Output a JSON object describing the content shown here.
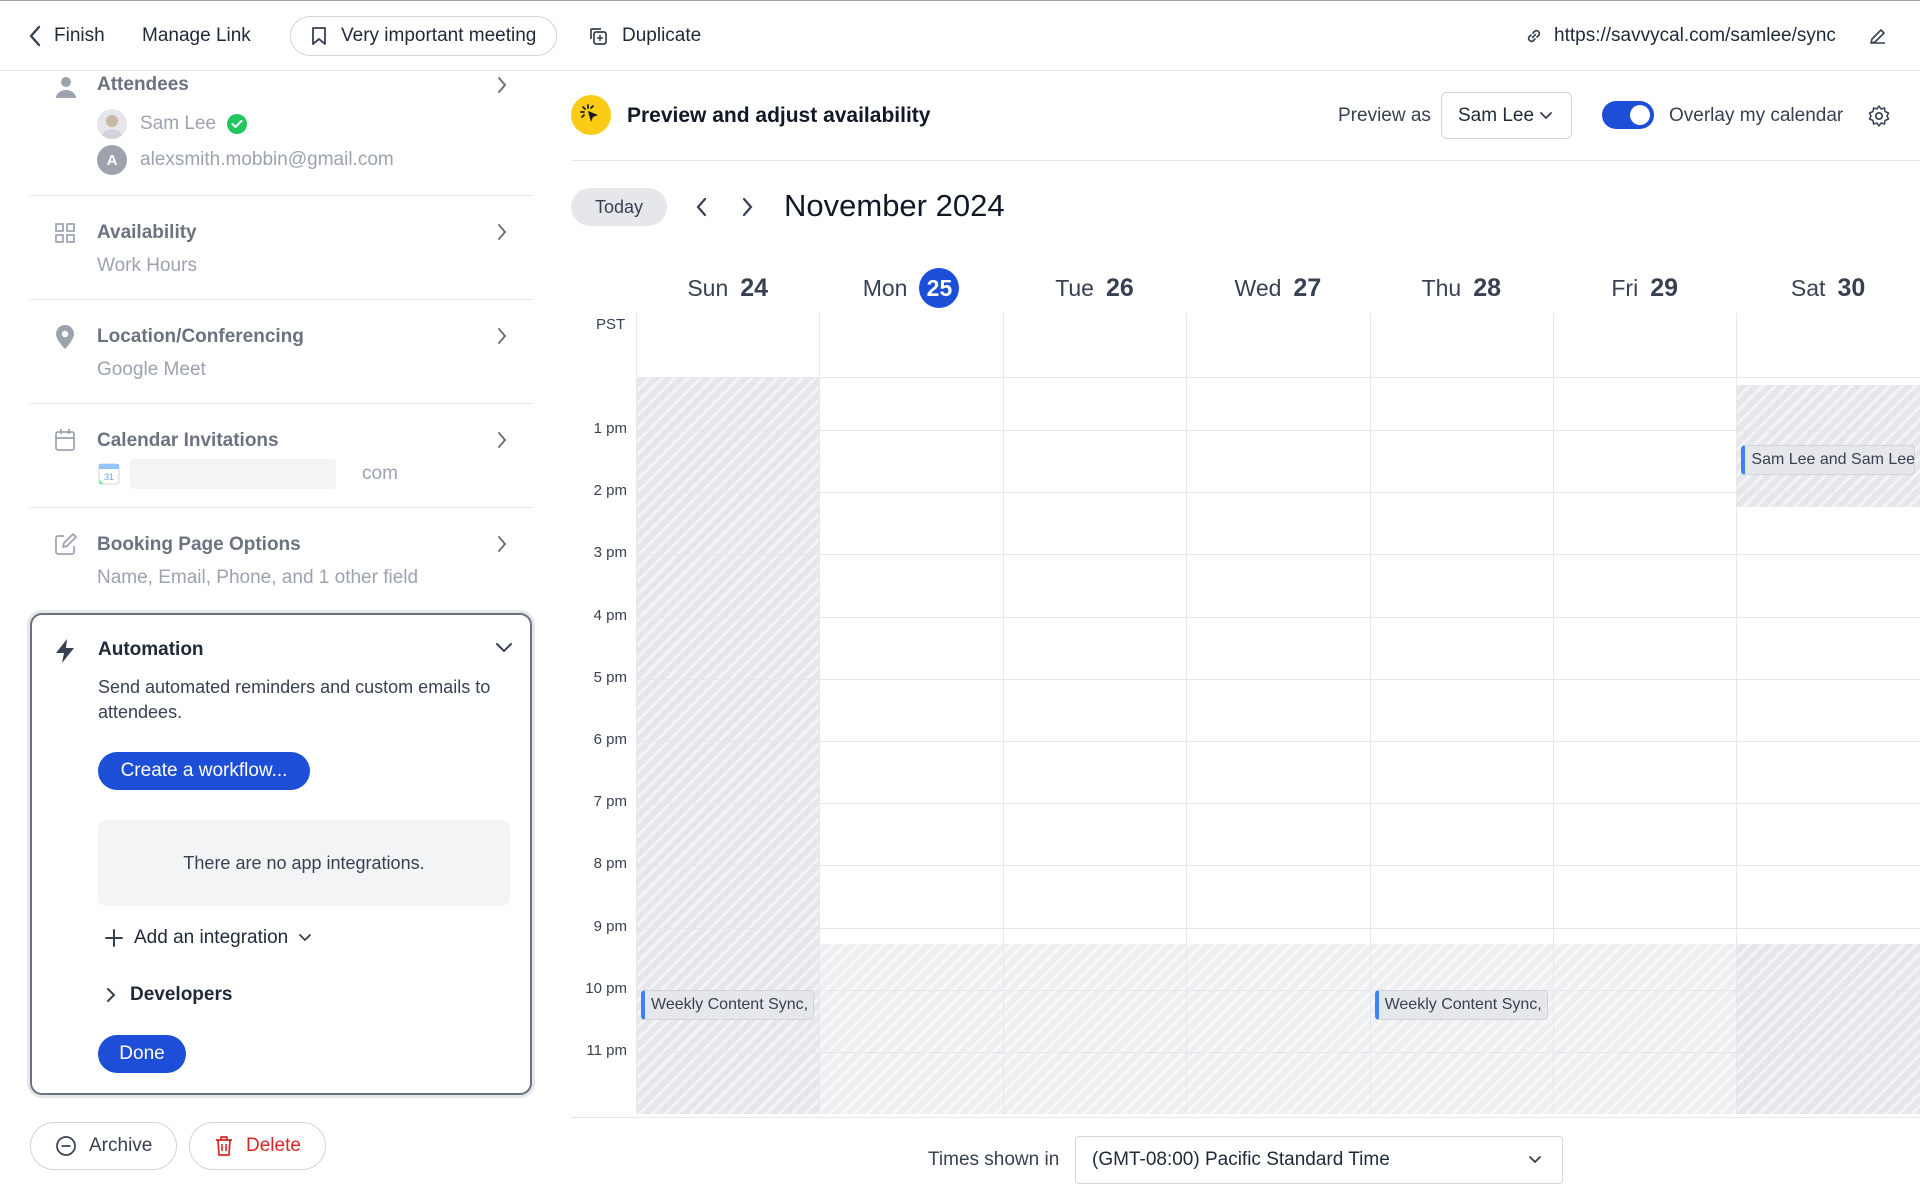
{
  "topbar": {
    "finish": "Finish",
    "manage_link": "Manage Link",
    "meeting_name": "Very important meeting",
    "duplicate": "Duplicate",
    "url": "https://savvycal.com/samlee/sync"
  },
  "sidebar": {
    "attendees": {
      "title": "Attendees",
      "people": [
        {
          "name": "Sam Lee",
          "verified": true
        },
        {
          "initial": "A",
          "name": "alexsmith.mobbin@gmail.com"
        }
      ]
    },
    "availability": {
      "title": "Availability",
      "subtitle": "Work Hours"
    },
    "location": {
      "title": "Location/Conferencing",
      "subtitle": "Google Meet"
    },
    "calendar_invitations": {
      "title": "Calendar Invitations",
      "subtitle_suffix": "com"
    },
    "booking_options": {
      "title": "Booking Page Options",
      "subtitle": "Name, Email, Phone, and 1 other field"
    },
    "automation": {
      "title": "Automation",
      "description": "Send automated reminders and custom emails to attendees.",
      "create_workflow": "Create a workflow...",
      "no_integrations": "There are no app integrations.",
      "add_integration": "Add an integration",
      "developers": "Developers",
      "done": "Done"
    },
    "archive": "Archive",
    "delete": "Delete"
  },
  "calendar": {
    "preview_title": "Preview and adjust availability",
    "preview_as_label": "Preview as",
    "preview_as_value": "Sam Lee",
    "overlay_label": "Overlay my calendar",
    "overlay_enabled": true,
    "today": "Today",
    "month": "November 2024",
    "timezone_abbr": "PST",
    "days": [
      {
        "name": "Sun",
        "num": "24",
        "today": false
      },
      {
        "name": "Mon",
        "num": "25",
        "today": true
      },
      {
        "name": "Tue",
        "num": "26",
        "today": false
      },
      {
        "name": "Wed",
        "num": "27",
        "today": false
      },
      {
        "name": "Thu",
        "num": "28",
        "today": false
      },
      {
        "name": "Fri",
        "num": "29",
        "today": false
      },
      {
        "name": "Sat",
        "num": "30",
        "today": false
      }
    ],
    "hours": [
      "1 pm",
      "2 pm",
      "3 pm",
      "4 pm",
      "5 pm",
      "6 pm",
      "7 pm",
      "8 pm",
      "9 pm",
      "10 pm",
      "11 pm"
    ],
    "events": [
      {
        "day": 6,
        "title": "Sam Lee and Sam Lee,"
      },
      {
        "day": 0,
        "title": "Weekly Content Sync,"
      },
      {
        "day": 4,
        "title": "Weekly Content Sync,"
      }
    ],
    "times_shown_label": "Times shown in",
    "timezone_value": "(GMT-08:00) Pacific Standard Time"
  },
  "colors": {
    "primary": "#1d4ed8",
    "danger": "#dc2626",
    "event_accent": "#3b82f6",
    "preview_badge": "#facc15"
  }
}
